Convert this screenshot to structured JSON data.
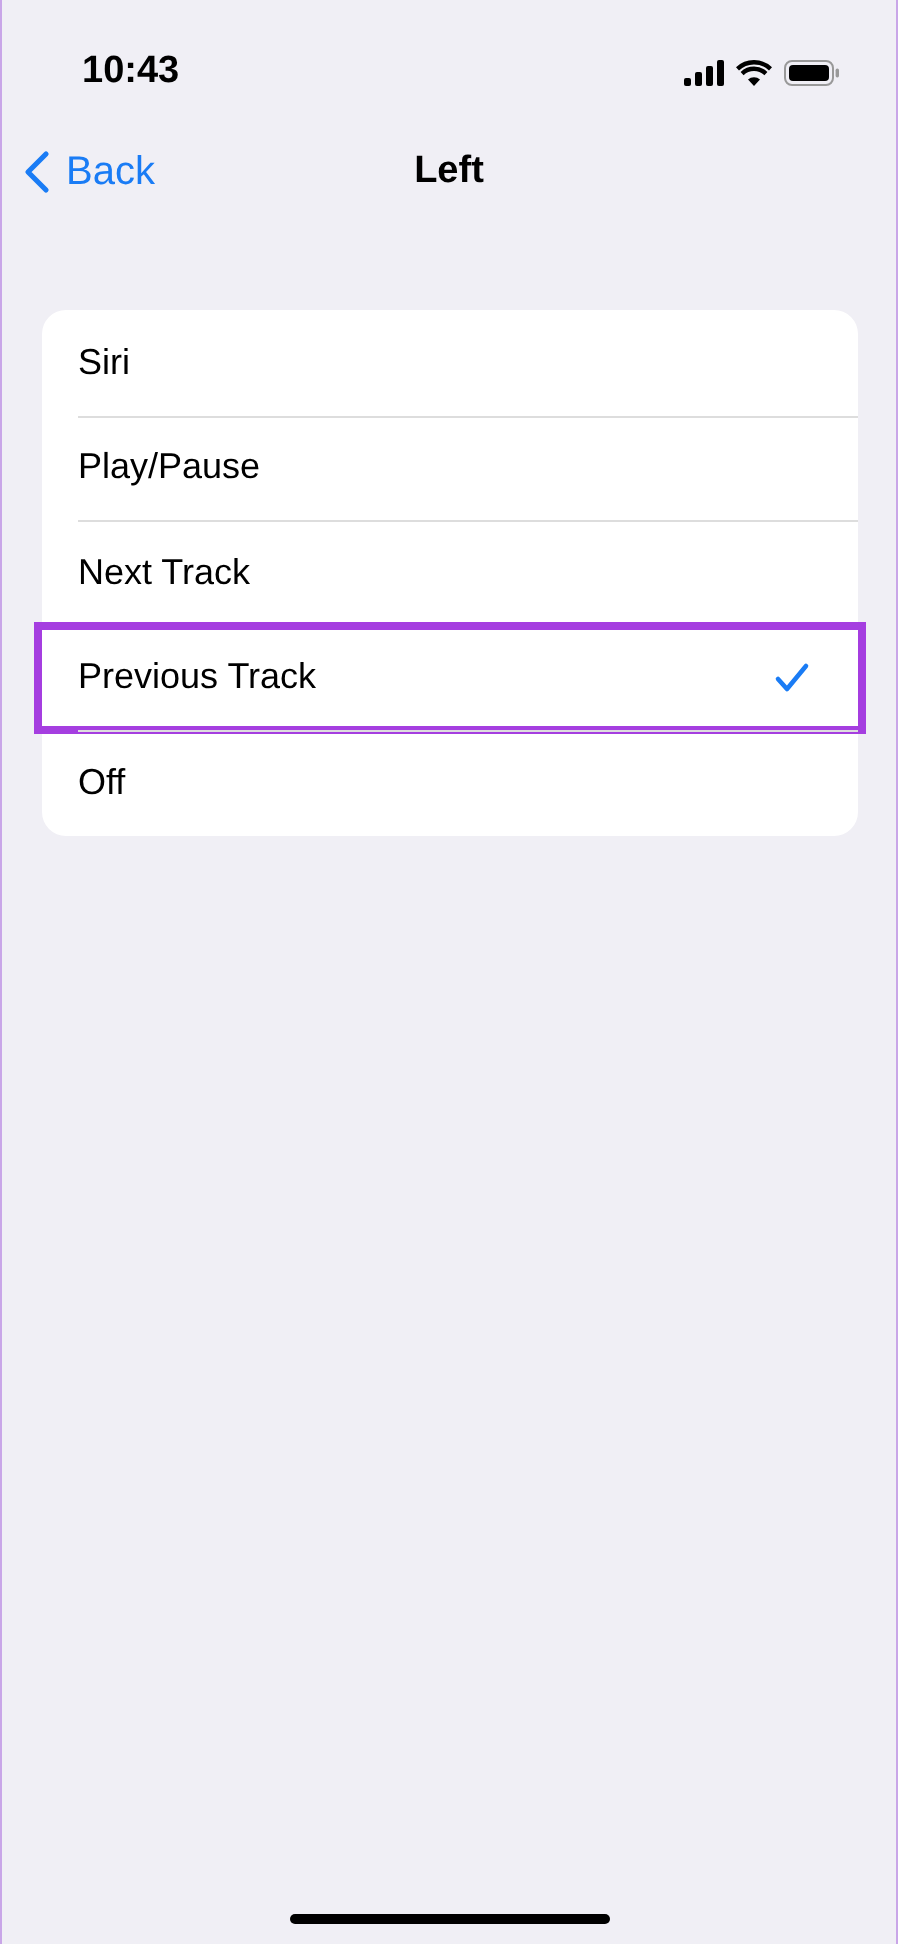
{
  "status_bar": {
    "time": "10:43"
  },
  "nav": {
    "back": "Back",
    "title": "Left"
  },
  "options": [
    {
      "label": "Siri",
      "selected": false,
      "highlighted": false
    },
    {
      "label": "Play/Pause",
      "selected": false,
      "highlighted": false
    },
    {
      "label": "Next Track",
      "selected": false,
      "highlighted": false
    },
    {
      "label": "Previous Track",
      "selected": true,
      "highlighted": true
    },
    {
      "label": "Off",
      "selected": false,
      "highlighted": false
    }
  ]
}
